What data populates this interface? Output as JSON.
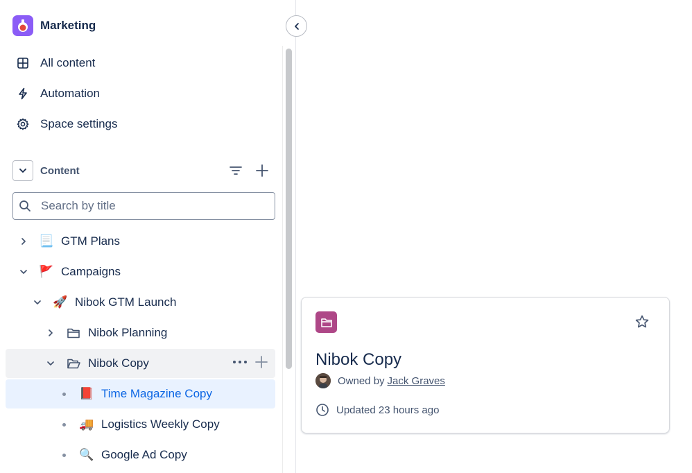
{
  "space": {
    "name": "Marketing"
  },
  "nav": [
    {
      "label": "All content",
      "icon": "grid-icon"
    },
    {
      "label": "Automation",
      "icon": "lightning-icon"
    },
    {
      "label": "Space settings",
      "icon": "gear-icon"
    }
  ],
  "content_section": {
    "title": "Content"
  },
  "search": {
    "placeholder": "Search by title",
    "value": ""
  },
  "tree": [
    {
      "label": "GTM Plans",
      "emoji": "📃",
      "state": "collapsed"
    },
    {
      "label": "Campaigns",
      "emoji": "🚩",
      "state": "expanded"
    },
    {
      "label": "Nibok GTM Launch",
      "emoji": "🚀",
      "state": "expanded"
    },
    {
      "label": "Nibok Planning",
      "icon": "folder-icon",
      "state": "collapsed"
    },
    {
      "label": "Nibok Copy",
      "icon": "folder-open-icon",
      "state": "expanded",
      "hover": true
    },
    {
      "label": "Time Magazine Copy",
      "emoji": "📕",
      "state": "leaf",
      "selected": true
    },
    {
      "label": "Logistics Weekly Copy",
      "emoji": "🚚",
      "state": "leaf"
    },
    {
      "label": "Google Ad Copy",
      "emoji": "🔍",
      "state": "leaf"
    }
  ],
  "card": {
    "title": "Nibok Copy",
    "owned_by_label": "Owned by",
    "owner": "Jack Graves",
    "updated": "Updated 23 hours ago"
  },
  "colors": {
    "accent": "#0c66e4",
    "folder_badge": "#ae4787",
    "space_logo": "#8b5cf6",
    "selected_bg": "#e9f2ff"
  }
}
